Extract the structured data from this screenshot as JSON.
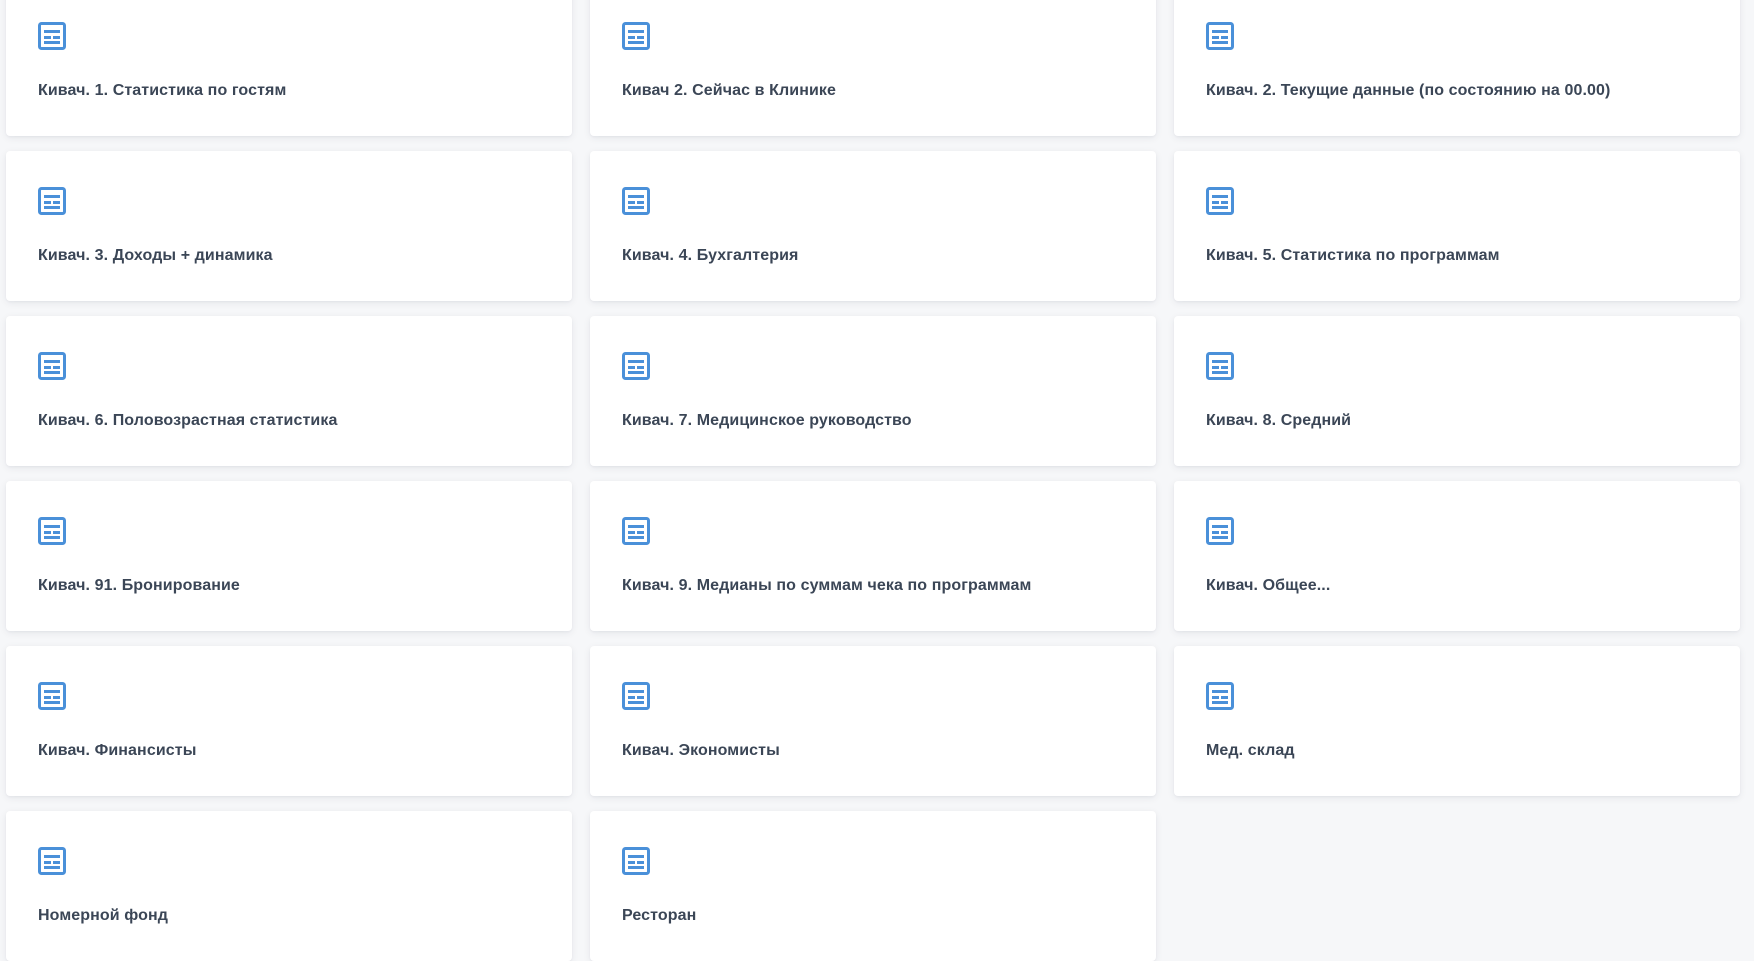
{
  "dashboards": {
    "icon": "dashboard-table-icon",
    "accent_color": "#4a90d9",
    "items": [
      {
        "title": "Кивач. 1. Статистика по гостям"
      },
      {
        "title": "Кивач 2. Сейчас в Клинике"
      },
      {
        "title": "Кивач. 2. Текущие данные (по состоянию на 00.00)"
      },
      {
        "title": "Кивач. 3. Доходы + динамика"
      },
      {
        "title": "Кивач. 4. Бухгалтерия"
      },
      {
        "title": "Кивач. 5. Статистика по программам"
      },
      {
        "title": "Кивач. 6. Половозрастная статистика"
      },
      {
        "title": "Кивач. 7. Медицинское руководство"
      },
      {
        "title": "Кивач. 8. Средний"
      },
      {
        "title": "Кивач. 91. Бронирование"
      },
      {
        "title": "Кивач. 9. Медианы по суммам чека по программам"
      },
      {
        "title": "Кивач. Общее..."
      },
      {
        "title": "Кивач. Финансисты"
      },
      {
        "title": "Кивач. Экономисты"
      },
      {
        "title": "Мед. склад"
      },
      {
        "title": "Номерной фонд"
      },
      {
        "title": "Ресторан"
      }
    ]
  }
}
